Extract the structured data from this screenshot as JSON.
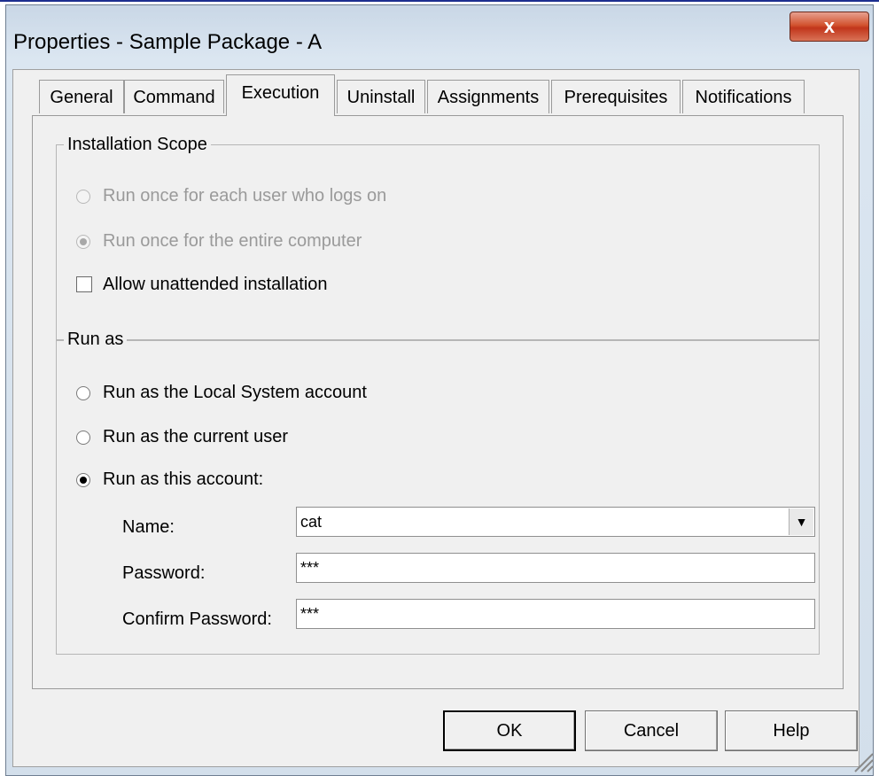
{
  "window": {
    "title": "Properties - Sample Package - A",
    "close_glyph": "x"
  },
  "tabs": [
    {
      "label": "General"
    },
    {
      "label": "Command"
    },
    {
      "label": "Execution"
    },
    {
      "label": "Uninstall"
    },
    {
      "label": "Assignments"
    },
    {
      "label": "Prerequisites"
    },
    {
      "label": "Notifications"
    }
  ],
  "active_tab": "Execution",
  "installation_scope": {
    "label": "Installation Scope",
    "options": [
      {
        "label": "Run once for each user who logs on",
        "selected": false,
        "enabled": false
      },
      {
        "label": "Run once for the entire computer",
        "selected": true,
        "enabled": false
      }
    ],
    "allow_unattended": {
      "label": "Allow unattended installation",
      "checked": false
    }
  },
  "run_as": {
    "label": "Run as",
    "options": [
      {
        "label": "Run as the Local System account",
        "selected": false
      },
      {
        "label": "Run as the current user",
        "selected": false
      },
      {
        "label": "Run as this account:",
        "selected": true
      }
    ],
    "name": {
      "label": "Name:",
      "value": "cat"
    },
    "password": {
      "label": "Password:",
      "value": "***"
    },
    "confirm_password": {
      "label": "Confirm Password:",
      "value": "***"
    }
  },
  "buttons": {
    "ok": "OK",
    "cancel": "Cancel",
    "help": "Help"
  },
  "icons": {
    "close": "close-icon",
    "dropdown": "chevron-down-icon",
    "resize": "resize-grip-icon"
  },
  "colors": {
    "title_bar": "#d3dfeb",
    "close_button": "#c1351b",
    "dialog_face": "#f0f0f0"
  }
}
